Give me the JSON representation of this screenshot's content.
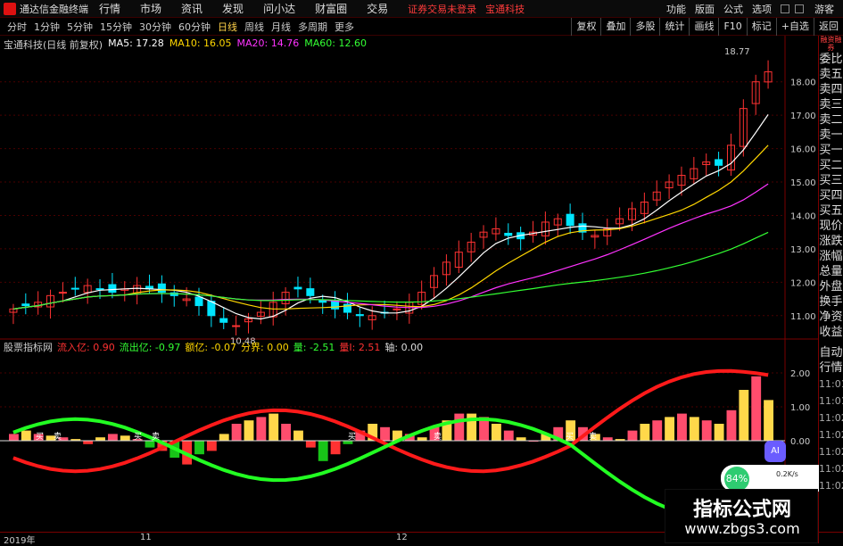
{
  "topbar": {
    "app_name": "通达信金融终端",
    "menus": [
      "行情",
      "市场",
      "资讯",
      "发现",
      "问小达",
      "财富圈",
      "交易"
    ],
    "warning": "证券交易未登录",
    "stock": "宝通科技",
    "right_menus": [
      "功能",
      "版面",
      "公式",
      "选项"
    ],
    "guest": "游客"
  },
  "periodbar": {
    "periods": [
      "分时",
      "1分钟",
      "5分钟",
      "15分钟",
      "30分钟",
      "60分钟",
      "日线",
      "周线",
      "月线",
      "多周期",
      "更多"
    ],
    "active": "日线",
    "tools": [
      "复权",
      "叠加",
      "多股",
      "统计",
      "画线",
      "F10",
      "标记",
      "+自选",
      "返回"
    ]
  },
  "main_legend": {
    "title": "宝通科技(日线 前复权)",
    "ma5": "MA5: 17.28",
    "ma10": "MA10: 16.05",
    "ma20": "MA20: 14.76",
    "ma60": "MA60: 12.60"
  },
  "price_axis": [
    "18.00",
    "17.00",
    "16.00",
    "15.00",
    "14.00",
    "13.00",
    "12.00",
    "11.00"
  ],
  "annotations": {
    "high": "18.77",
    "low": "10.48"
  },
  "indicator_legend": {
    "name": "股票指标网",
    "inflow": "流入亿: 0.90",
    "outflow": "流出亿: -0.97",
    "net": "额亿: -0.07",
    "boundary": "分界: 0.00",
    "vol_a": "量: -2.51",
    "vol_b": "量I: 2.51",
    "axis": "轴: 0.00"
  },
  "indicator_axis": [
    "2.00",
    "1.00",
    "0.00"
  ],
  "signal_labels": [
    "买",
    "卖"
  ],
  "sidebar": {
    "tag": "融资融券",
    "order_items": [
      "委比",
      "卖五",
      "卖四",
      "卖三",
      "卖二",
      "卖一",
      "买一",
      "买二",
      "买三",
      "买四",
      "买五",
      "现价",
      "涨跌",
      "涨幅",
      "总量",
      "外盘",
      "换手",
      "净资",
      "收益"
    ],
    "auto": "自动",
    "quote": "行情",
    "times": [
      "11:01",
      "11:01",
      "11:02",
      "11:02",
      "11:02",
      "11:02",
      "11:02"
    ]
  },
  "date_axis": [
    "2019年",
    "11",
    "12"
  ],
  "overlay": {
    "ai": "AI",
    "percent": "84%",
    "speed": "0.2K/s"
  },
  "watermark": {
    "title": "指标公式网",
    "url": "www.zbgs3.com"
  },
  "colors": {
    "up": "#ff3232",
    "down": "#00e5ff",
    "ma5": "#ffffff",
    "ma10": "#ffd700",
    "ma20": "#ff33ff",
    "ma60": "#33ff33",
    "grid": "#7a0000"
  }
}
